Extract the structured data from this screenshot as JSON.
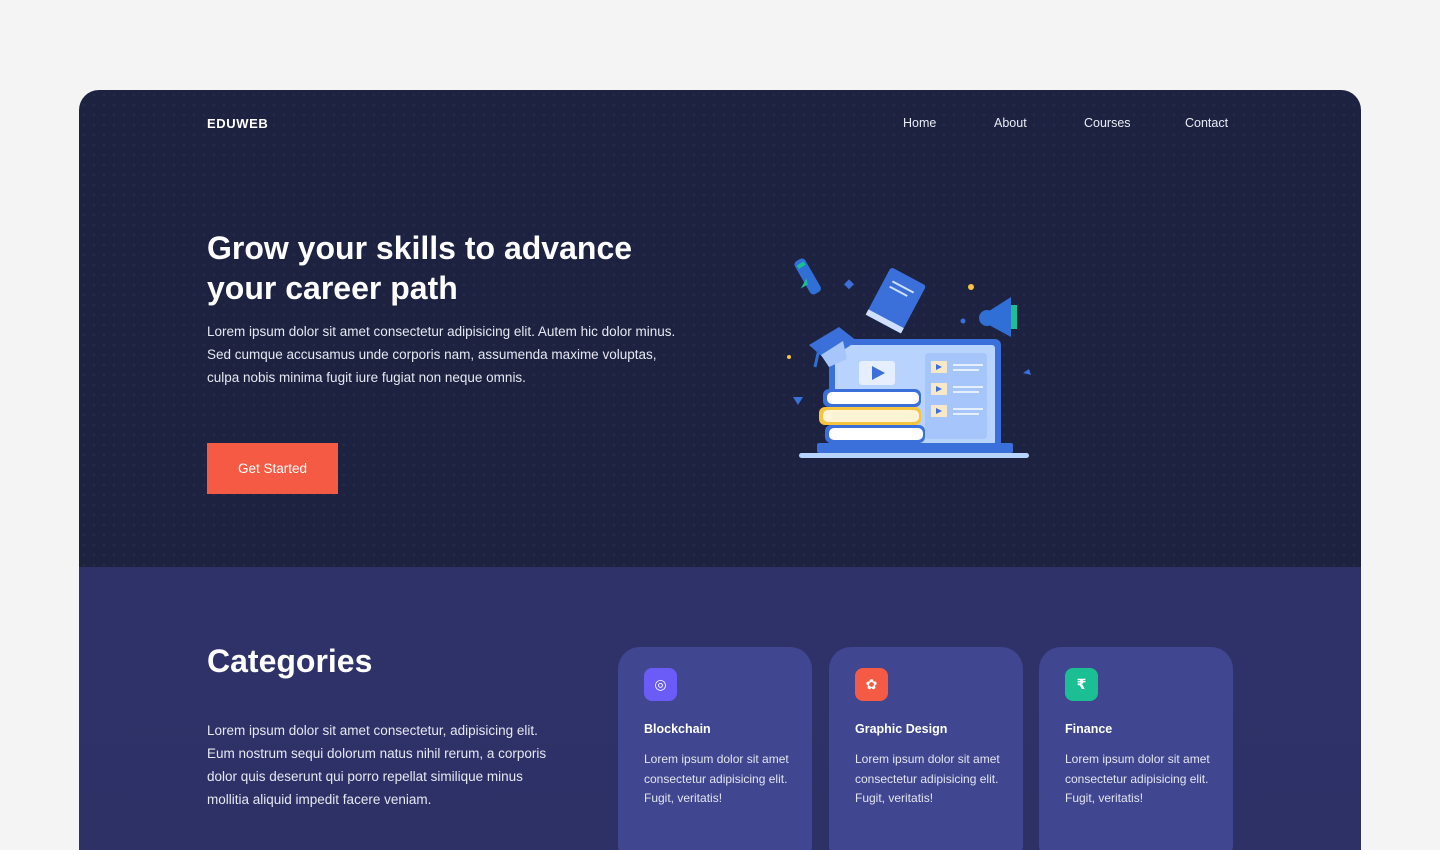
{
  "header": {
    "logo": "EDUWEB",
    "nav": [
      {
        "label": "Home"
      },
      {
        "label": "About"
      },
      {
        "label": "Courses"
      },
      {
        "label": "Contact"
      }
    ]
  },
  "hero": {
    "title": "Grow your skills to advance your career path",
    "description": "Lorem ipsum dolor sit amet consectetur adipisicing elit. Autem hic dolor minus. Sed cumque accusamus unde corporis nam, assumenda maxime voluptas, culpa nobis minima fugit iure fugiat non neque omnis.",
    "cta_label": "Get Started"
  },
  "categories": {
    "title": "Categories",
    "description": "Lorem ipsum dolor sit amet consectetur, adipisicing elit. Eum nostrum sequi dolorum natus nihil rerum, a corporis dolor quis deserunt qui porro repellat similique minus mollitia aliquid impedit facere veniam.",
    "cards": [
      {
        "icon": "blockchain-icon",
        "icon_glyph": "◎",
        "color": "#6c5cf7",
        "title": "Blockchain",
        "description": "Lorem ipsum dolor sit amet consectetur adipisicing elit. Fugit, veritatis!"
      },
      {
        "icon": "palette-icon",
        "icon_glyph": "✿",
        "color": "#f45a44",
        "title": "Graphic Design",
        "description": "Lorem ipsum dolor sit amet consectetur adipisicing elit. Fugit, veritatis!"
      },
      {
        "icon": "rupee-icon",
        "icon_glyph": "₹",
        "color": "#1cbf94",
        "title": "Finance",
        "description": "Lorem ipsum dolor sit amet consectetur adipisicing elit. Fugit, veritatis!"
      }
    ]
  },
  "colors": {
    "hero_bg": "#1d2240",
    "section_bg": "#2f3269",
    "card_bg": "#40468f",
    "accent": "#f45a44"
  }
}
